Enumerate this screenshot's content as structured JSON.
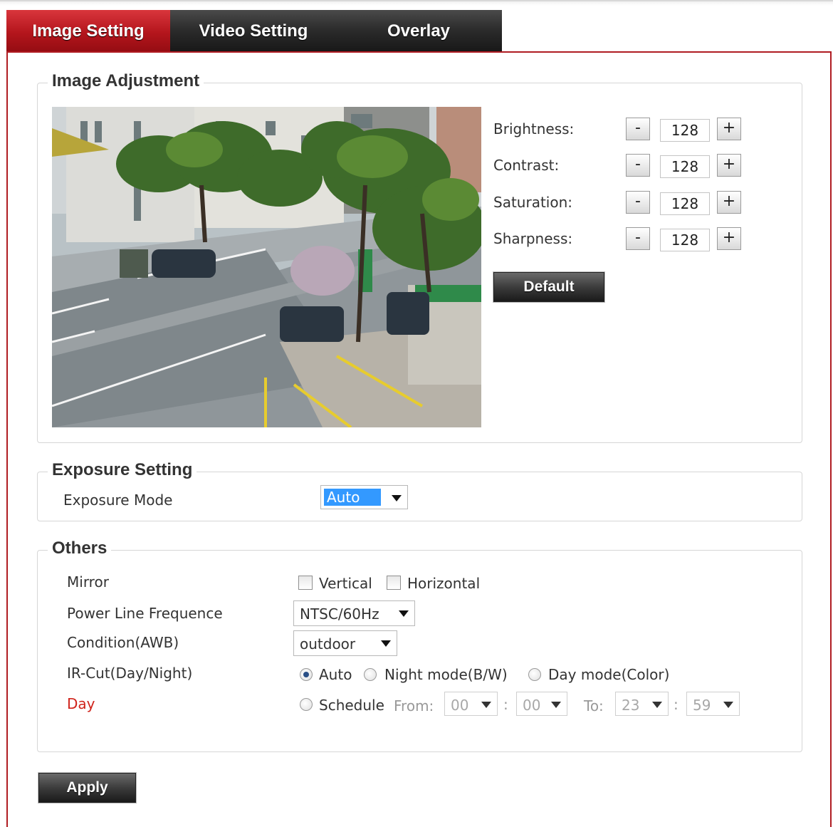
{
  "tabs": [
    {
      "label": "Image Setting",
      "active": true
    },
    {
      "label": "Video Setting",
      "active": false
    },
    {
      "label": "Overlay",
      "active": false
    }
  ],
  "image_adjustment": {
    "legend": "Image Adjustment",
    "rows": [
      {
        "label": "Brightness:",
        "value": "128",
        "minus": "-",
        "plus": "+"
      },
      {
        "label": "Contrast:",
        "value": "128",
        "minus": "-",
        "plus": "+"
      },
      {
        "label": "Saturation:",
        "value": "128",
        "minus": "-",
        "plus": "+"
      },
      {
        "label": "Sharpness:",
        "value": "128",
        "minus": "-",
        "plus": "+"
      }
    ],
    "default_label": "Default"
  },
  "exposure": {
    "legend": "Exposure Setting",
    "mode_label": "Exposure Mode",
    "mode_value": "Auto"
  },
  "others": {
    "legend": "Others",
    "mirror_label": "Mirror",
    "mirror_vertical": "Vertical",
    "mirror_horizontal": "Horizontal",
    "power_label": "Power Line Frequence",
    "power_value": "NTSC/60Hz",
    "awb_label": "Condition(AWB)",
    "awb_value": "outdoor",
    "ircut_label": "IR-Cut(Day/Night)",
    "ircut_auto": "Auto",
    "ircut_night": "Night mode(B/W)",
    "ircut_day": "Day mode(Color)",
    "ircut_selected": "Auto",
    "day_label": "Day",
    "schedule_label": "Schedule",
    "from_label": "From:",
    "to_label": "To:",
    "colon": ":",
    "from_hour": "00",
    "from_min": "00",
    "to_hour": "23",
    "to_min": "59"
  },
  "apply_label": "Apply",
  "colors": {
    "accent_red": "#b01c22",
    "tab_dark": "#2c2c2c",
    "day_label": "#d0241c",
    "selection": "#3399ff"
  }
}
